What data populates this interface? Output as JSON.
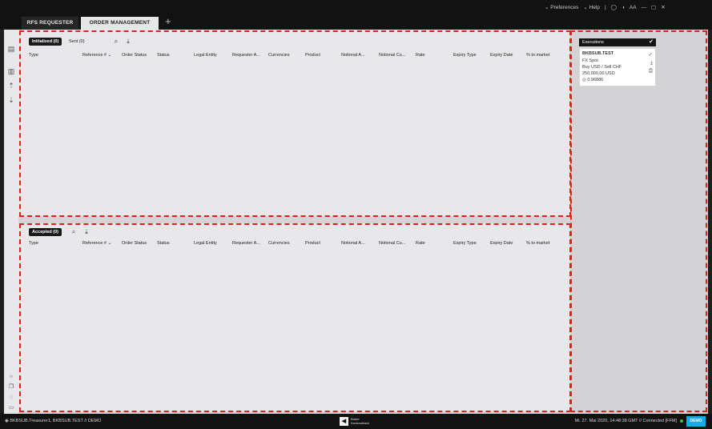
{
  "tabs": {
    "rfs": "RFS REQUESTER",
    "order": "ORDER MANAGEMENT",
    "add": "+"
  },
  "window": {
    "preferences": "Preferences",
    "help": "Help",
    "font": "AA"
  },
  "top_panel": {
    "initialized": "Initialized (0)",
    "sent": "Sent (0)"
  },
  "bottom_panel": {
    "accepted": "Accepted (0)"
  },
  "columns": [
    "Type",
    "Reference #",
    "Order Status",
    "Status",
    "Legal Entity",
    "Requester A...",
    "Currencies",
    "Product",
    "Notional A...",
    "Notional Cu...",
    "Rate",
    "Expiry Type",
    "Expiry Date",
    "% to market"
  ],
  "executions": {
    "title": "Executions",
    "card": {
      "entity": "BKBSUB.TEST",
      "product": "FX Spot",
      "side": "Buy USD / Sell CHF",
      "amount": "250,000.00 USD",
      "rate": "0.96886"
    }
  },
  "status_bar": {
    "user": "BKBSUB.Treasurer1, BKBSUB.TEST  //  DEMO",
    "logo_line1": "Basler",
    "logo_line2": "Kantonalbank",
    "datetime": "Mi. 27. Mai 2020, 14:48:38 GMT  //  Connected  [FFM]",
    "demo_badge": "DEMO"
  },
  "colors": {
    "annotation_red": "#e0201c",
    "demo_blue": "#19a9e5",
    "connected_green": "#2ecc40",
    "dark_bar": "#121212"
  }
}
